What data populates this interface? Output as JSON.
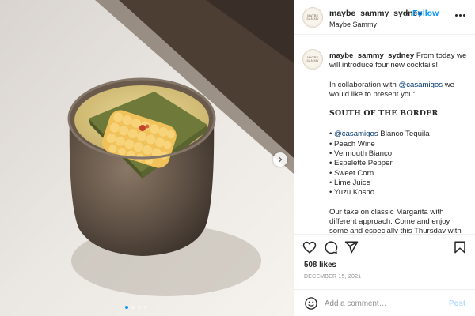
{
  "post": {
    "username": "maybe_sammy_sydney",
    "subtitle": "Maybe Sammy",
    "follow_label": "Follow",
    "separator": "•",
    "avatar_logo_text": "MAYBE SAMMY",
    "caption": {
      "intro": "From today we will introduce four new cocktails!",
      "collab_prefix": "In collaboration with ",
      "collab_handle": "@casamigos",
      "collab_suffix": " we would like to present you:",
      "title": "SOUTH OF THE BORDER",
      "ingredients": [
        {
          "bullet": "• ",
          "handle": "@casamigos",
          "text": " Blanco Tequila"
        },
        {
          "bullet": "• ",
          "handle": "",
          "text": "Peach Wine"
        },
        {
          "bullet": "• ",
          "handle": "",
          "text": "Vermouth Bianco"
        },
        {
          "bullet": "• ",
          "handle": "",
          "text": "Espelette Pepper"
        },
        {
          "bullet": "• ",
          "handle": "",
          "text": "Sweet Corn"
        },
        {
          "bullet": "• ",
          "handle": "",
          "text": "Lime Juice"
        },
        {
          "bullet": "• ",
          "handle": "",
          "text": "Yuzu Kosho"
        }
      ],
      "outro": "Our take on classic Margarita with different approach. Come and enjoy some and especially this Thursday with"
    },
    "likes": "508 likes",
    "date": "December 15, 2021",
    "comment_placeholder": "Add a comment…",
    "post_label": "Post",
    "carousel": {
      "count": 4,
      "active": 0
    },
    "icons": {
      "like": "heart-icon",
      "comment": "comment-icon",
      "share": "share-icon",
      "save": "bookmark-icon",
      "emoji": "emoji-icon",
      "more": "more-options-icon",
      "next": "chevron-right-icon"
    },
    "colors": {
      "accent": "#0095f6",
      "link": "#00376b",
      "muted": "#8e8e8e"
    }
  }
}
